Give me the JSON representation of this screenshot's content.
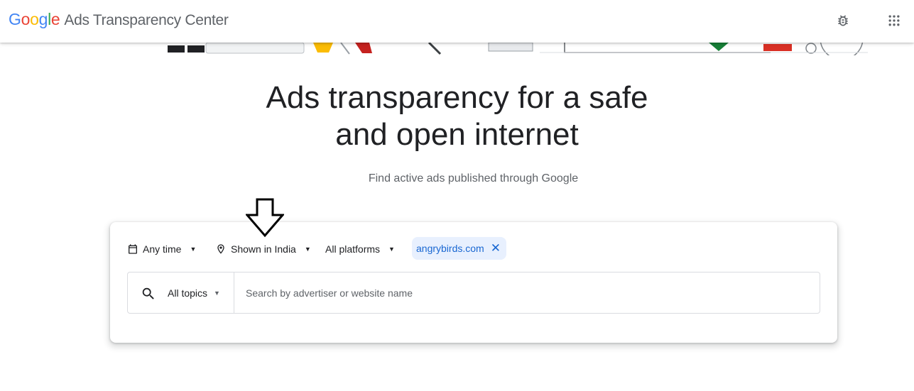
{
  "header": {
    "logo_letters": [
      "G",
      "o",
      "o",
      "g",
      "l",
      "e"
    ],
    "product_name": "Ads Transparency Center",
    "icons": [
      "bug-report-icon",
      "apps-grid-icon"
    ]
  },
  "hero": {
    "title_line1": "Ads transparency for a safe",
    "title_line2": "and open internet",
    "subtitle": "Find active ads published through Google"
  },
  "filters": {
    "date": {
      "label": "Any time",
      "icon": "calendar-icon"
    },
    "region": {
      "label": "Shown in India",
      "icon": "location-pin-icon"
    },
    "platform": {
      "label": "All platforms"
    },
    "active_chip": {
      "label": "angrybirds.com",
      "remove_icon": "close-icon"
    }
  },
  "search": {
    "topics_label": "All topics",
    "placeholder": "Search by advertiser or website name",
    "value": ""
  },
  "colors": {
    "google_blue": "#4285F4",
    "google_red": "#EA4335",
    "google_yellow": "#FBBC05",
    "google_green": "#34A853",
    "chip_bg": "#e8f0fe",
    "chip_text": "#1967d2"
  }
}
